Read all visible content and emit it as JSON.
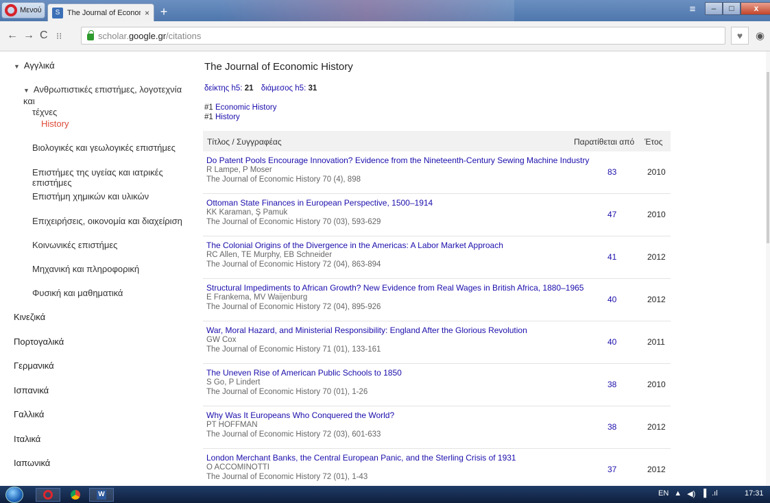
{
  "browser": {
    "menu_label": "Μενού",
    "tab_title": "The Journal of Economic H",
    "tab_close": "×",
    "new_tab": "+",
    "url_prefix": "scholar.",
    "url_domain": "google.gr",
    "url_path": "/citations"
  },
  "sidebar": {
    "language_english": "Αγγλικά",
    "subcategory_humanities_line1": "Ανθρωπιστικές επιστήμες, λογοτεχνία και",
    "subcategory_humanities_line2": "τέχνες",
    "active_item": "History",
    "items": [
      "Βιολογικές και γεωλογικές επιστήμες",
      "Επιστήμες της υγείας και ιατρικές επιστήμες",
      "Επιστήμη χημικών και υλικών",
      "Επιχειρήσεις, οικονομία και διαχείριση",
      "Κοινωνικές επιστήμες",
      "Μηχανική και πληροφορική",
      "Φυσική και μαθηματικά"
    ],
    "languages": [
      "Κινεζικά",
      "Πορτογαλικά",
      "Γερμανικά",
      "Ισπανικά",
      "Γαλλικά",
      "Ιταλικά",
      "Ιαπωνικά"
    ]
  },
  "main": {
    "title": "The Journal of Economic History",
    "h5_index_label": "δείκτης h5:",
    "h5_index_value": "21",
    "h5_median_label": "διάμεσος h5:",
    "h5_median_value": "31",
    "rank1_prefix": "#1",
    "rank1_cat": "Economic History",
    "rank2_prefix": "#1",
    "rank2_cat": "History",
    "col_title": "Τίτλος / Συγγραφέας",
    "col_cited": "Παρατίθεται από",
    "col_year": "Έτος",
    "rows": [
      {
        "title": "Do Patent Pools Encourage Innovation? Evidence from the Nineteenth-Century Sewing Machine Industry",
        "authors": "R Lampe, P Moser",
        "source": "The Journal of Economic History 70 (4), 898",
        "cited": "83",
        "year": "2010"
      },
      {
        "title": "Ottoman State Finances in European Perspective, 1500–1914",
        "authors": "KK Karaman, Ş Pamuk",
        "source": "The Journal of Economic History 70 (03), 593-629",
        "cited": "47",
        "year": "2010"
      },
      {
        "title": "The Colonial Origins of the Divergence in the Americas: A Labor Market Approach",
        "authors": "RC Allen, TE Murphy, EB Schneider",
        "source": "The Journal of Economic History 72 (04), 863-894",
        "cited": "41",
        "year": "2012"
      },
      {
        "title": "Structural Impediments to African Growth? New Evidence from Real Wages in British Africa, 1880–1965",
        "authors": "E Frankema, MV Waijenburg",
        "source": "The Journal of Economic History 72 (04), 895-926",
        "cited": "40",
        "year": "2012"
      },
      {
        "title": "War, Moral Hazard, and Ministerial Responsibility: England After the Glorious Revolution",
        "authors": "GW Cox",
        "source": "The Journal of Economic History 71 (01), 133-161",
        "cited": "40",
        "year": "2011"
      },
      {
        "title": "The Uneven Rise of American Public Schools to 1850",
        "authors": "S Go, P Lindert",
        "source": "The Journal of Economic History 70 (01), 1-26",
        "cited": "38",
        "year": "2010"
      },
      {
        "title": "Why Was It Europeans Who Conquered the World?",
        "authors": "PT HOFFMAN",
        "source": "The Journal of Economic History 72 (03), 601-633",
        "cited": "38",
        "year": "2012"
      },
      {
        "title": "London Merchant Banks, the Central European Panic, and the Sterling Crisis of 1931",
        "authors": "O ACCOMINOTTI",
        "source": "The Journal of Economic History 72 (01), 1-43",
        "cited": "37",
        "year": "2012"
      }
    ]
  },
  "taskbar": {
    "lang": "EN",
    "time": "17:31"
  }
}
